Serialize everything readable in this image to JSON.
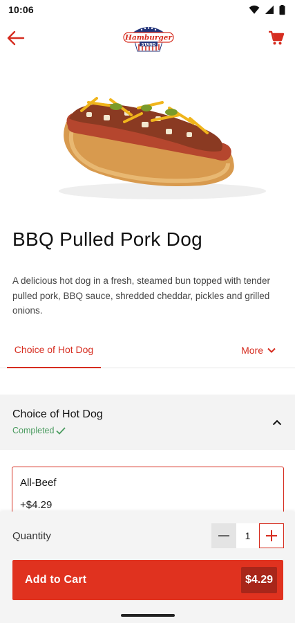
{
  "status_bar": {
    "time": "10:06",
    "icons": [
      "wifi-icon",
      "signal-icon",
      "battery-icon"
    ]
  },
  "header": {
    "back_icon": "arrow-left-icon",
    "logo_text": "Hamburger",
    "logo_subtext": "STAND",
    "cart_icon": "shopping-cart-icon"
  },
  "product": {
    "title": "BBQ Pulled Pork Dog",
    "description": "A delicious hot dog in a fresh, steamed bun topped with tender pulled pork, BBQ sauce, shredded cheddar, pickles and grilled onions."
  },
  "tabs": {
    "active": "Choice of Hot Dog",
    "more": "More"
  },
  "section": {
    "title": "Choice of Hot Dog",
    "status": "Completed"
  },
  "option": {
    "name": "All-Beef",
    "price": "+$4.29"
  },
  "quantity": {
    "label": "Quantity",
    "value": "1"
  },
  "add_to_cart": {
    "label": "Add to Cart",
    "price": "$4.29"
  },
  "colors": {
    "brand_red": "#e0321f",
    "accent_red": "#d62d20",
    "completed_green": "#4a9b5f"
  }
}
